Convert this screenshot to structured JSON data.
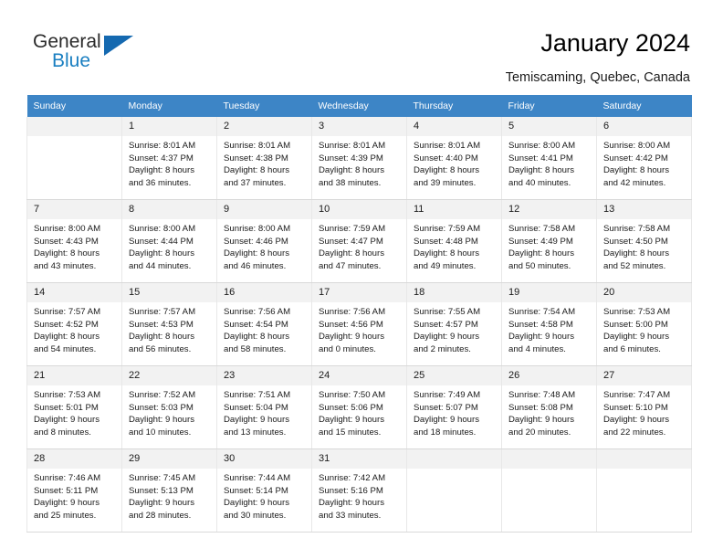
{
  "brand": {
    "name_part1": "General",
    "name_part2": "Blue",
    "triangle_color": "#1569b0",
    "blue_color": "#1a7fc1"
  },
  "header": {
    "title": "January 2024",
    "subtitle": "Temiscaming, Quebec, Canada"
  },
  "calendar": {
    "header_bg": "#3d85c6",
    "daynum_bg": "#f2f2f2",
    "weekdays": [
      "Sunday",
      "Monday",
      "Tuesday",
      "Wednesday",
      "Thursday",
      "Friday",
      "Saturday"
    ],
    "weeks": [
      [
        {
          "empty": true,
          "day": "",
          "l1": "",
          "l2": "",
          "l3": "",
          "l4": ""
        },
        {
          "empty": false,
          "day": "1",
          "l1": "Sunrise: 8:01 AM",
          "l2": "Sunset: 4:37 PM",
          "l3": "Daylight: 8 hours",
          "l4": "and 36 minutes."
        },
        {
          "empty": false,
          "day": "2",
          "l1": "Sunrise: 8:01 AM",
          "l2": "Sunset: 4:38 PM",
          "l3": "Daylight: 8 hours",
          "l4": "and 37 minutes."
        },
        {
          "empty": false,
          "day": "3",
          "l1": "Sunrise: 8:01 AM",
          "l2": "Sunset: 4:39 PM",
          "l3": "Daylight: 8 hours",
          "l4": "and 38 minutes."
        },
        {
          "empty": false,
          "day": "4",
          "l1": "Sunrise: 8:01 AM",
          "l2": "Sunset: 4:40 PM",
          "l3": "Daylight: 8 hours",
          "l4": "and 39 minutes."
        },
        {
          "empty": false,
          "day": "5",
          "l1": "Sunrise: 8:00 AM",
          "l2": "Sunset: 4:41 PM",
          "l3": "Daylight: 8 hours",
          "l4": "and 40 minutes."
        },
        {
          "empty": false,
          "day": "6",
          "l1": "Sunrise: 8:00 AM",
          "l2": "Sunset: 4:42 PM",
          "l3": "Daylight: 8 hours",
          "l4": "and 42 minutes."
        }
      ],
      [
        {
          "empty": false,
          "day": "7",
          "l1": "Sunrise: 8:00 AM",
          "l2": "Sunset: 4:43 PM",
          "l3": "Daylight: 8 hours",
          "l4": "and 43 minutes."
        },
        {
          "empty": false,
          "day": "8",
          "l1": "Sunrise: 8:00 AM",
          "l2": "Sunset: 4:44 PM",
          "l3": "Daylight: 8 hours",
          "l4": "and 44 minutes."
        },
        {
          "empty": false,
          "day": "9",
          "l1": "Sunrise: 8:00 AM",
          "l2": "Sunset: 4:46 PM",
          "l3": "Daylight: 8 hours",
          "l4": "and 46 minutes."
        },
        {
          "empty": false,
          "day": "10",
          "l1": "Sunrise: 7:59 AM",
          "l2": "Sunset: 4:47 PM",
          "l3": "Daylight: 8 hours",
          "l4": "and 47 minutes."
        },
        {
          "empty": false,
          "day": "11",
          "l1": "Sunrise: 7:59 AM",
          "l2": "Sunset: 4:48 PM",
          "l3": "Daylight: 8 hours",
          "l4": "and 49 minutes."
        },
        {
          "empty": false,
          "day": "12",
          "l1": "Sunrise: 7:58 AM",
          "l2": "Sunset: 4:49 PM",
          "l3": "Daylight: 8 hours",
          "l4": "and 50 minutes."
        },
        {
          "empty": false,
          "day": "13",
          "l1": "Sunrise: 7:58 AM",
          "l2": "Sunset: 4:50 PM",
          "l3": "Daylight: 8 hours",
          "l4": "and 52 minutes."
        }
      ],
      [
        {
          "empty": false,
          "day": "14",
          "l1": "Sunrise: 7:57 AM",
          "l2": "Sunset: 4:52 PM",
          "l3": "Daylight: 8 hours",
          "l4": "and 54 minutes."
        },
        {
          "empty": false,
          "day": "15",
          "l1": "Sunrise: 7:57 AM",
          "l2": "Sunset: 4:53 PM",
          "l3": "Daylight: 8 hours",
          "l4": "and 56 minutes."
        },
        {
          "empty": false,
          "day": "16",
          "l1": "Sunrise: 7:56 AM",
          "l2": "Sunset: 4:54 PM",
          "l3": "Daylight: 8 hours",
          "l4": "and 58 minutes."
        },
        {
          "empty": false,
          "day": "17",
          "l1": "Sunrise: 7:56 AM",
          "l2": "Sunset: 4:56 PM",
          "l3": "Daylight: 9 hours",
          "l4": "and 0 minutes."
        },
        {
          "empty": false,
          "day": "18",
          "l1": "Sunrise: 7:55 AM",
          "l2": "Sunset: 4:57 PM",
          "l3": "Daylight: 9 hours",
          "l4": "and 2 minutes."
        },
        {
          "empty": false,
          "day": "19",
          "l1": "Sunrise: 7:54 AM",
          "l2": "Sunset: 4:58 PM",
          "l3": "Daylight: 9 hours",
          "l4": "and 4 minutes."
        },
        {
          "empty": false,
          "day": "20",
          "l1": "Sunrise: 7:53 AM",
          "l2": "Sunset: 5:00 PM",
          "l3": "Daylight: 9 hours",
          "l4": "and 6 minutes."
        }
      ],
      [
        {
          "empty": false,
          "day": "21",
          "l1": "Sunrise: 7:53 AM",
          "l2": "Sunset: 5:01 PM",
          "l3": "Daylight: 9 hours",
          "l4": "and 8 minutes."
        },
        {
          "empty": false,
          "day": "22",
          "l1": "Sunrise: 7:52 AM",
          "l2": "Sunset: 5:03 PM",
          "l3": "Daylight: 9 hours",
          "l4": "and 10 minutes."
        },
        {
          "empty": false,
          "day": "23",
          "l1": "Sunrise: 7:51 AM",
          "l2": "Sunset: 5:04 PM",
          "l3": "Daylight: 9 hours",
          "l4": "and 13 minutes."
        },
        {
          "empty": false,
          "day": "24",
          "l1": "Sunrise: 7:50 AM",
          "l2": "Sunset: 5:06 PM",
          "l3": "Daylight: 9 hours",
          "l4": "and 15 minutes."
        },
        {
          "empty": false,
          "day": "25",
          "l1": "Sunrise: 7:49 AM",
          "l2": "Sunset: 5:07 PM",
          "l3": "Daylight: 9 hours",
          "l4": "and 18 minutes."
        },
        {
          "empty": false,
          "day": "26",
          "l1": "Sunrise: 7:48 AM",
          "l2": "Sunset: 5:08 PM",
          "l3": "Daylight: 9 hours",
          "l4": "and 20 minutes."
        },
        {
          "empty": false,
          "day": "27",
          "l1": "Sunrise: 7:47 AM",
          "l2": "Sunset: 5:10 PM",
          "l3": "Daylight: 9 hours",
          "l4": "and 22 minutes."
        }
      ],
      [
        {
          "empty": false,
          "day": "28",
          "l1": "Sunrise: 7:46 AM",
          "l2": "Sunset: 5:11 PM",
          "l3": "Daylight: 9 hours",
          "l4": "and 25 minutes."
        },
        {
          "empty": false,
          "day": "29",
          "l1": "Sunrise: 7:45 AM",
          "l2": "Sunset: 5:13 PM",
          "l3": "Daylight: 9 hours",
          "l4": "and 28 minutes."
        },
        {
          "empty": false,
          "day": "30",
          "l1": "Sunrise: 7:44 AM",
          "l2": "Sunset: 5:14 PM",
          "l3": "Daylight: 9 hours",
          "l4": "and 30 minutes."
        },
        {
          "empty": false,
          "day": "31",
          "l1": "Sunrise: 7:42 AM",
          "l2": "Sunset: 5:16 PM",
          "l3": "Daylight: 9 hours",
          "l4": "and 33 minutes."
        },
        {
          "empty": true,
          "day": "",
          "l1": "",
          "l2": "",
          "l3": "",
          "l4": ""
        },
        {
          "empty": true,
          "day": "",
          "l1": "",
          "l2": "",
          "l3": "",
          "l4": ""
        },
        {
          "empty": true,
          "day": "",
          "l1": "",
          "l2": "",
          "l3": "",
          "l4": ""
        }
      ]
    ]
  }
}
